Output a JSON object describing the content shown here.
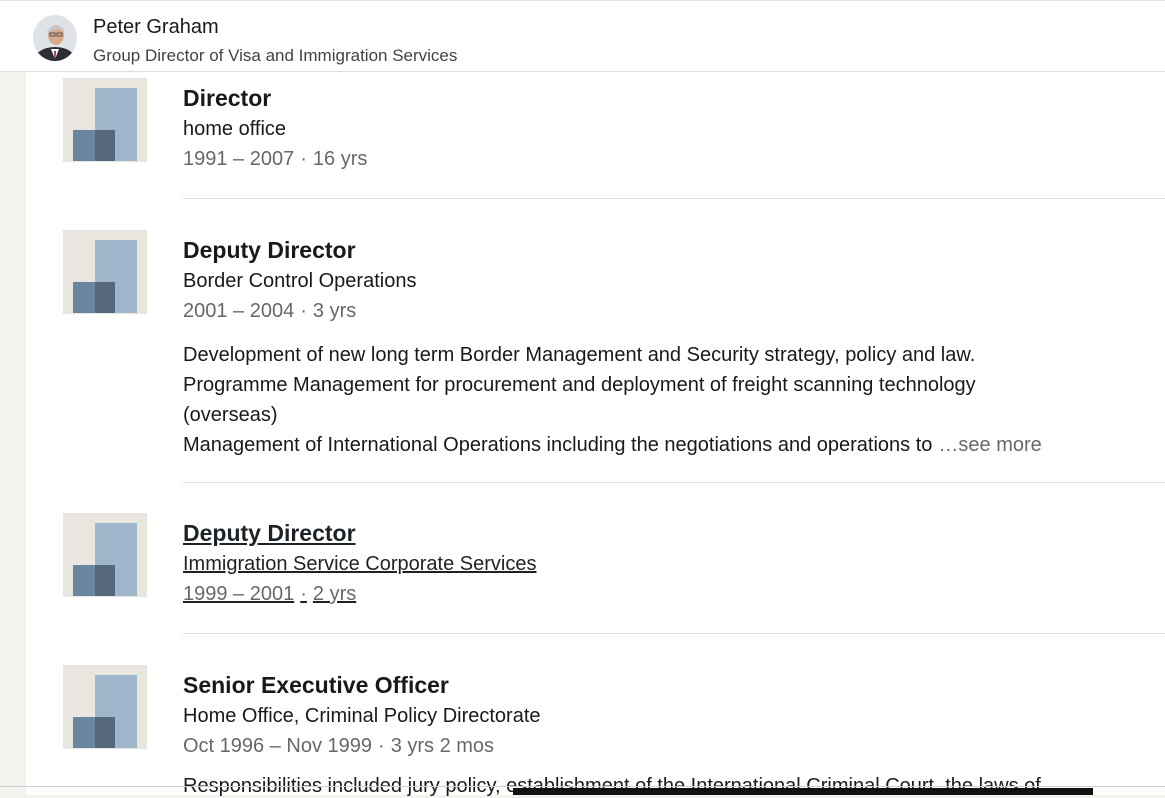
{
  "header": {
    "name": "Peter Graham",
    "headline": "Group Director of Visa and Immigration Services"
  },
  "experience": [
    {
      "title": "Director",
      "company": "home office",
      "date_range": "1991 – 2007",
      "duration": "16 yrs"
    },
    {
      "title": "Deputy Director",
      "company": "Border Control Operations",
      "date_range": "2001 – 2004",
      "duration": "3 yrs",
      "description": [
        "Development of new long term Border Management and Security strategy, policy and law.",
        "Programme Management for procurement and deployment of freight scanning technology",
        "(overseas)",
        "Management of International Operations including the negotiations and operations to"
      ],
      "see_more": "…see more"
    },
    {
      "title": "Deputy Director",
      "company": "Immigration Service Corporate Services",
      "date_range": "1999 – 2001",
      "duration": "2 yrs"
    },
    {
      "title": "Senior Executive Officer",
      "company": "Home Office, Criminal Policy Directorate",
      "date_range": "Oct 1996 – Nov 1999",
      "duration": "3 yrs 2 mos",
      "description_partial": "Responsibilities included jury policy, establishment of the International Criminal Court, the laws of"
    }
  ],
  "separator": "·",
  "colors": {
    "logo_bg": "#e9e5df",
    "logo_light": "#9fb7cc",
    "logo_mid": "#6b86a0",
    "logo_dark": "#56687c"
  }
}
